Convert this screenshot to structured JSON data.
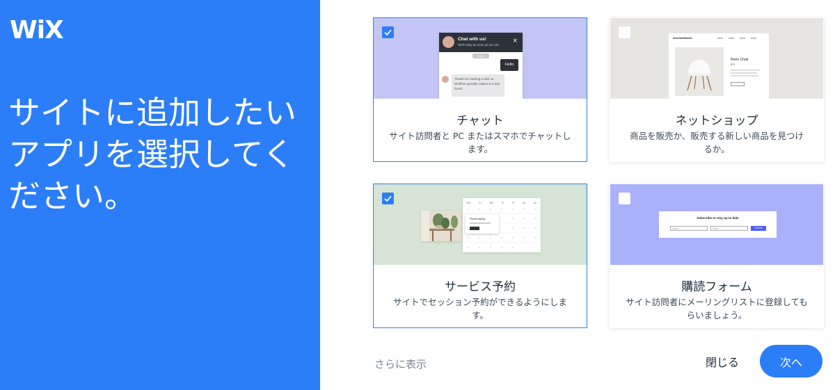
{
  "brand": {
    "logo": "WiX"
  },
  "headline": "サイトに追加したいアプリを選択してください。",
  "cards": [
    {
      "title": "チャット",
      "description": "サイト訪問者と PC またはスマホでチャットします。",
      "checked": true,
      "preview": {
        "header_title": "Chat with us!",
        "header_sub": "We'll reply as soon as we can",
        "pill": "Today",
        "user_bubble": "Hello",
        "bot_bubble": "Thanks for starting a with us. Wolfhan typically replies in a few hours."
      }
    },
    {
      "title": "ネットショップ",
      "description": "商品を販売か、販売する新しい商品を見つけるか。",
      "checked": false,
      "preview": {
        "store_name": "mountainflowers",
        "product_name": "Retro Chair",
        "price": "$75"
      }
    },
    {
      "title": "サービス予約",
      "description": "サイトでセッション予約ができるようにします。",
      "checked": true,
      "preview": {
        "weekdays": [
          "Mo",
          "Tu",
          "We",
          "Th",
          "Fr",
          "Sa",
          "Su"
        ],
        "event_label": "Plants styling"
      }
    },
    {
      "title": "購読フォーム",
      "description": "サイト訪問者にメーリングリストに登録してもらいましょう。",
      "checked": false,
      "preview": {
        "form_title": "Subscribe to stay up to date",
        "name_placeholder": "Name",
        "email_placeholder": "Email",
        "submit_label": "Submit"
      }
    }
  ],
  "footer": {
    "more_link": "さらに表示",
    "close_label": "閉じる",
    "next_label": "次へ"
  },
  "colors": {
    "primary": "#2b7ef8",
    "chat_preview_bg": "#c3c6f5",
    "store_preview_bg": "#e6e5e2",
    "booking_preview_bg": "#d6e4d5",
    "subscribe_preview_bg": "#a9b1fb"
  }
}
